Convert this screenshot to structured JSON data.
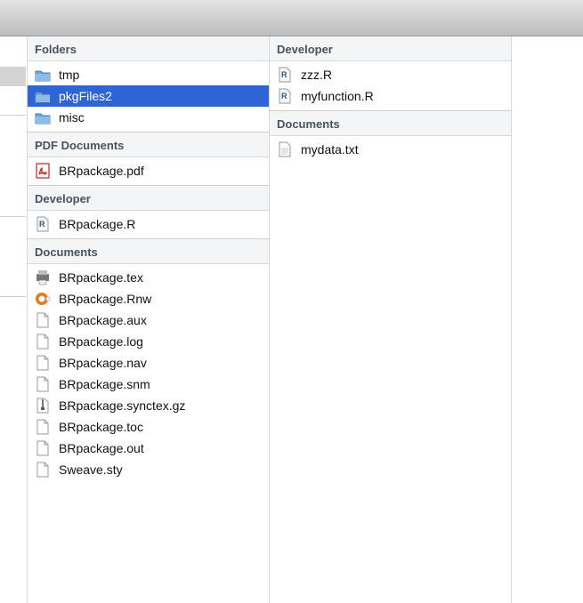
{
  "column1": {
    "sections": [
      {
        "title": "Folders",
        "items": [
          {
            "name": "tmp",
            "icon": "folder-icon",
            "selected": false
          },
          {
            "name": "pkgFiles2",
            "icon": "folder-icon",
            "selected": true
          },
          {
            "name": "misc",
            "icon": "folder-icon",
            "selected": false
          }
        ]
      },
      {
        "title": "PDF Documents",
        "items": [
          {
            "name": "BRpackage.pdf",
            "icon": "pdf-document-icon"
          }
        ]
      },
      {
        "title": "Developer",
        "items": [
          {
            "name": "BRpackage.R",
            "icon": "r-script-icon"
          }
        ]
      },
      {
        "title": "Documents",
        "items": [
          {
            "name": "BRpackage.tex",
            "icon": "tex-document-icon"
          },
          {
            "name": "BRpackage.Rnw",
            "icon": "rnw-document-icon"
          },
          {
            "name": "BRpackage.aux",
            "icon": "generic-document-icon"
          },
          {
            "name": "BRpackage.log",
            "icon": "generic-document-icon"
          },
          {
            "name": "BRpackage.nav",
            "icon": "generic-document-icon"
          },
          {
            "name": "BRpackage.snm",
            "icon": "generic-document-icon"
          },
          {
            "name": "BRpackage.synctex.gz",
            "icon": "archive-document-icon"
          },
          {
            "name": "BRpackage.toc",
            "icon": "generic-document-icon"
          },
          {
            "name": "BRpackage.out",
            "icon": "generic-document-icon"
          },
          {
            "name": "Sweave.sty",
            "icon": "generic-document-icon"
          }
        ]
      }
    ]
  },
  "column2": {
    "sections": [
      {
        "title": "Developer",
        "items": [
          {
            "name": "zzz.R",
            "icon": "r-script-icon"
          },
          {
            "name": "myfunction.R",
            "icon": "r-script-icon"
          }
        ]
      },
      {
        "title": "Documents",
        "items": [
          {
            "name": "mydata.txt",
            "icon": "text-document-icon"
          }
        ]
      }
    ]
  },
  "colors": {
    "selection": "#2f64d6",
    "section_header_text": "#4a5261",
    "folder": "#6fa6d8"
  }
}
